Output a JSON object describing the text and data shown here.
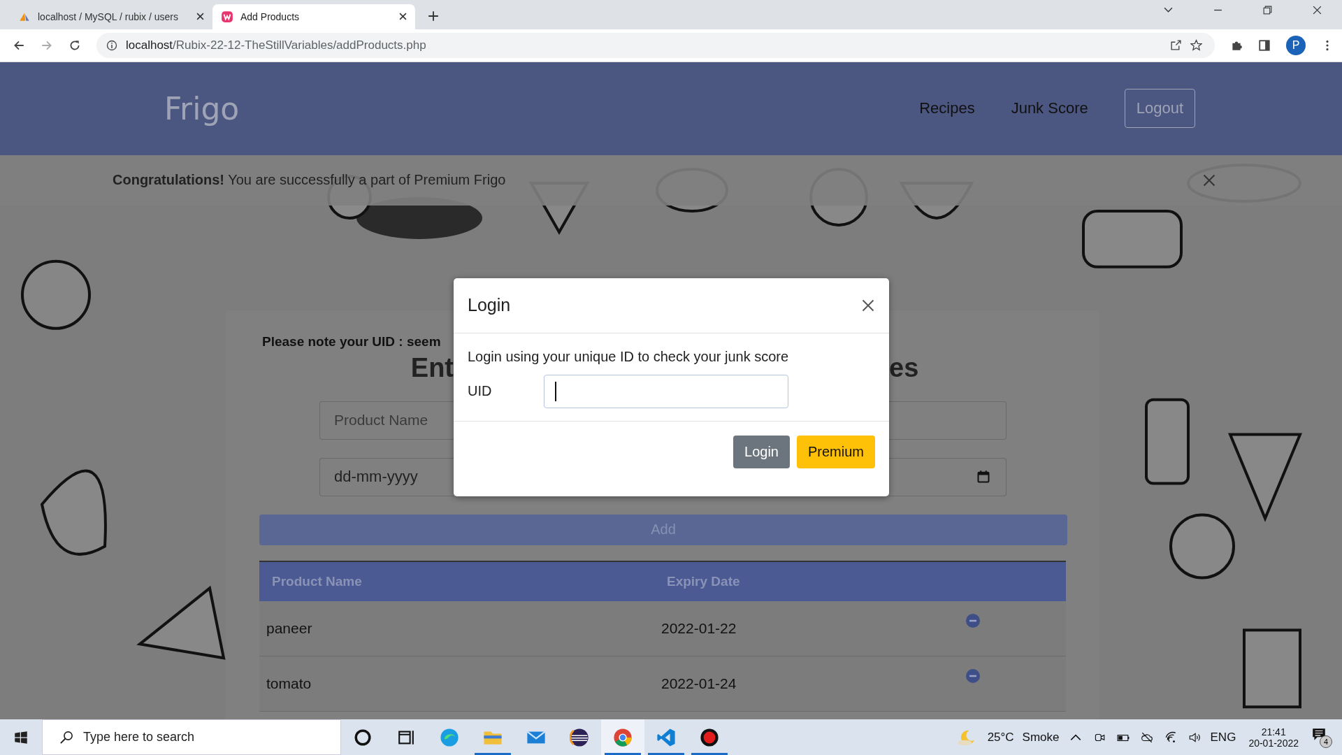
{
  "browser": {
    "tabs": [
      {
        "title": "localhost / MySQL / rubix / users",
        "selected": false,
        "kind": "pma"
      },
      {
        "title": "Add Products",
        "selected": true,
        "kind": "wamp"
      }
    ],
    "url_host": "localhost",
    "url_path": "/Rubix-22-12-TheStillVariables/addProducts.php",
    "profile_initial": "P"
  },
  "navbar": {
    "brand": "Frigo",
    "links": [
      "Recipes",
      "Junk Score"
    ],
    "logout": "Logout"
  },
  "alert": {
    "text": "**Congratulations!** You are successfully a part of Premium Frigo"
  },
  "form": {
    "uid_note": "Please note your UID : seem",
    "heading_start": "Ent",
    "heading_end": "es",
    "product_placeholder": "Product Name",
    "date_format": "dd-mm-yyyy",
    "add_button": "Add"
  },
  "table": {
    "columns": [
      "Product Name",
      "Expiry Date"
    ],
    "rows": [
      {
        "product": "paneer",
        "expiry": "2022-01-22"
      },
      {
        "product": "tomato",
        "expiry": "2022-01-24"
      }
    ]
  },
  "modal": {
    "title": "Login",
    "message": "Login using your unique ID to check your junk score",
    "uid_label": "UID",
    "buttons": [
      {
        "label": "Login",
        "kind": "secondary"
      },
      {
        "label": "Premium",
        "kind": "warning"
      }
    ]
  },
  "taskbar": {
    "search_placeholder": "Type here to search",
    "apps": [
      {
        "kind": "cortana",
        "running": false,
        "selected": false
      },
      {
        "kind": "taskview",
        "running": false,
        "selected": false
      },
      {
        "kind": "edge",
        "running": false,
        "selected": false
      },
      {
        "kind": "explorer",
        "running": true,
        "selected": false
      },
      {
        "kind": "mail",
        "running": false,
        "selected": false
      },
      {
        "kind": "eclipse",
        "running": false,
        "selected": false
      },
      {
        "kind": "chrome",
        "running": true,
        "selected": true
      },
      {
        "kind": "vscode",
        "running": true,
        "selected": false
      },
      {
        "kind": "recorder",
        "running": true,
        "selected": false
      }
    ],
    "temperature": "25°C",
    "weather": "Smoke",
    "language": "ENG",
    "time": "21:41",
    "date": "20-01-2022",
    "notifications": "4"
  }
}
